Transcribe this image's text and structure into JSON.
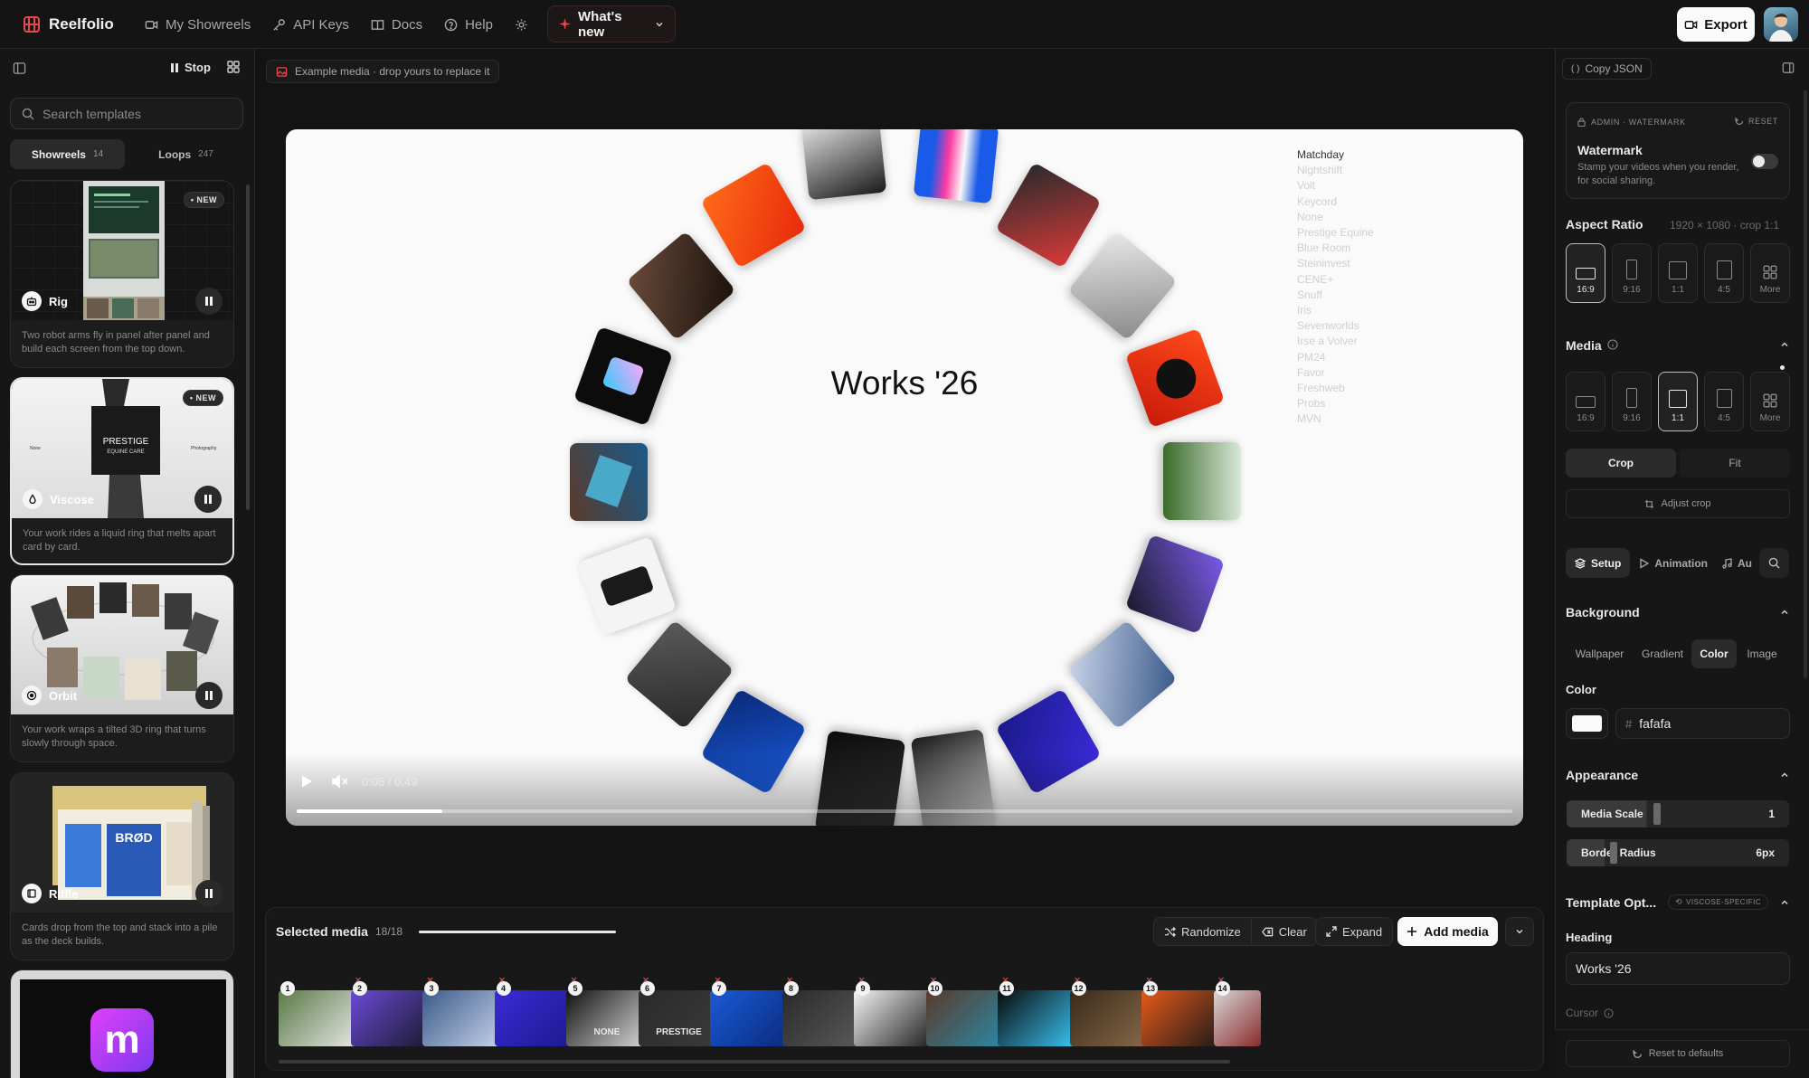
{
  "app": {
    "name": "Reelfolio"
  },
  "nav": [
    {
      "label": "My Showreels",
      "icon": "video-icon"
    },
    {
      "label": "API Keys",
      "icon": "key-icon"
    },
    {
      "label": "Docs",
      "icon": "book-icon"
    },
    {
      "label": "Help",
      "icon": "help-icon"
    }
  ],
  "whats_new": "What's new",
  "export_label": "Export",
  "left": {
    "stop_label": "Stop",
    "search_placeholder": "Search templates",
    "tabs": [
      {
        "label": "Showreels",
        "count": "14"
      },
      {
        "label": "Loops",
        "count": "247"
      }
    ],
    "new_badge": "• NEW",
    "templates": [
      {
        "name": "Rig",
        "desc": "Two robot arms fly in panel after panel and build each screen from the top down.",
        "new": true
      },
      {
        "name": "Viscose",
        "desc": "Your work rides a liquid ring that melts apart card by card.",
        "new": true,
        "card_text": "PRESTIGE EQUINE CARE"
      },
      {
        "name": "Orbit",
        "desc": "Your work wraps a tilted 3D ring that turns slowly through space.",
        "new": false
      },
      {
        "name": "Riffle",
        "desc": "Cards drop from the top and stack into a pile as the deck builds.",
        "new": false,
        "card_text": "BRØD"
      },
      {
        "name": "",
        "desc": "",
        "new": false,
        "logo_letter": "m"
      }
    ]
  },
  "example_banner": "Example media · drop yours to replace it",
  "stage": {
    "title": "Works '26",
    "menu": [
      "Matchday",
      "Nightshift",
      "Volt",
      "Keycord",
      "None",
      "Prestige Equine",
      "Blue Room",
      "Steininvest",
      "CENE+",
      "Snuff",
      "Iris",
      "Sevenworlds",
      "Irse a Volver",
      "PM24",
      "Favor",
      "Freshweb",
      "Probs",
      "MVN"
    ],
    "time": "0:05 / 0:49",
    "progress": 0.12
  },
  "tray": {
    "title": "Selected media",
    "count": "18/18",
    "buttons": [
      "Randomize",
      "Clear",
      "Expand"
    ],
    "add_label": "Add media",
    "items": [
      {
        "n": "1",
        "c1": "#5a7a45",
        "c2": "#e8e8e8"
      },
      {
        "n": "2",
        "c1": "#6a4ad8",
        "c2": "#1a1a2a"
      },
      {
        "n": "3",
        "c1": "#3a5a8a",
        "c2": "#c8d4e8"
      },
      {
        "n": "4",
        "c1": "#3a2ad8",
        "c2": "#1a1a8a"
      },
      {
        "n": "5",
        "c1": "#111111",
        "c2": "#d8d8d8",
        "label": "NONE"
      },
      {
        "n": "6",
        "c1": "#2a2a2a",
        "c2": "#3a3a3a",
        "label": "PRESTIGE"
      },
      {
        "n": "7",
        "c1": "#1a5ad8",
        "c2": "#0a2a7a"
      },
      {
        "n": "8",
        "c1": "#2a2a2a",
        "c2": "#5a5a5a"
      },
      {
        "n": "9",
        "c1": "#f5f5f5",
        "c2": "#1a1a1a"
      },
      {
        "n": "10",
        "c1": "#5a3a2a",
        "c2": "#2a8aa8"
      },
      {
        "n": "11",
        "c1": "#0a0a0a",
        "c2": "#3ac8f8"
      },
      {
        "n": "12",
        "c1": "#3a2a1a",
        "c2": "#8a6a4a"
      },
      {
        "n": "13",
        "c1": "#e85a1a",
        "c2": "#1a1a1a"
      },
      {
        "n": "14",
        "c1": "#d8d8d8",
        "c2": "#8a2a2a"
      }
    ]
  },
  "right": {
    "copy_json": "Copy JSON",
    "admin_label": "ADMIN · WATERMARK",
    "reset": "RESET",
    "watermark_title": "Watermark",
    "watermark_desc": "Stamp your videos when you render, for social sharing.",
    "aspect_title": "Aspect Ratio",
    "aspect_info": "1920 × 1080 · crop 1:1",
    "aspect_options": [
      "16:9",
      "9:16",
      "1:1",
      "4:5",
      "More"
    ],
    "aspect_selected": "16:9",
    "media_title": "Media",
    "media_options": [
      "16:9",
      "9:16",
      "1:1",
      "4:5",
      "More"
    ],
    "media_selected": "1:1",
    "crop": "Crop",
    "fit": "Fit",
    "adjust_crop": "Adjust crop",
    "tabs": [
      "Setup",
      "Animation",
      "Au"
    ],
    "background_title": "Background",
    "bg_options": [
      "Wallpaper",
      "Gradient",
      "Color",
      "Image"
    ],
    "bg_selected": "Color",
    "color_label": "Color",
    "color_hash": "#",
    "color_value": "fafafa",
    "appearance_title": "Appearance",
    "media_scale_label": "Media Scale",
    "media_scale_value": "1",
    "border_radius_label": "Border Radius",
    "border_radius_value": "6px",
    "template_opts_title": "Template Opt...",
    "viscose_badge": "VISCOSE-SPECIFIC",
    "heading_label": "Heading",
    "heading_value": "Works '26",
    "cursor_label": "Cursor",
    "reset_defaults": "Reset to defaults"
  },
  "colors": {
    "accent": "#e5484d",
    "stage_bg": "#fafafa",
    "panel_bg": "#161616"
  }
}
